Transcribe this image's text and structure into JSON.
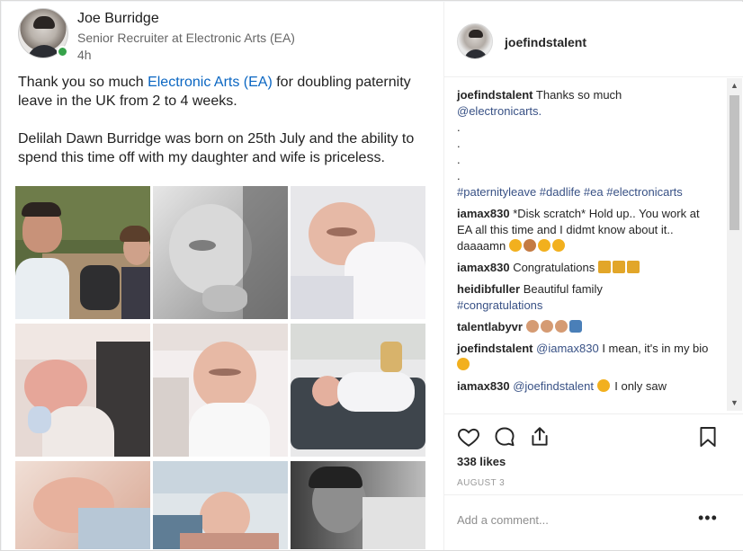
{
  "linkedin": {
    "author_name": "Joe Burridge",
    "author_title": "Senior Recruiter at Electronic Arts (EA)",
    "time_ago": "4h",
    "post_para1_a": "Thank you so much ",
    "post_para1_link": "Electronic Arts (EA)",
    "post_para1_b": " for doubling paternity leave in the UK from 2 to 4 weeks.",
    "post_para2": "Delilah Dawn Burridge was born on 25th July and the ability to spend this time off with my daughter and wife is priceless."
  },
  "instagram": {
    "username": "joefindstalent",
    "comments": [
      {
        "user": "joefindstalent",
        "text": "Thanks so much",
        "tags": [
          "@electronicarts."
        ],
        "dots": [
          ".",
          ".",
          ".",
          "."
        ],
        "hashtags": "#paternityleave #dadlife #ea #electronicarts"
      },
      {
        "user": "iamax830",
        "text": "*Disk scratch* Hold up.. You work at EA all this time and I didmt know about it.. daaaamn"
      },
      {
        "user": "iamax830",
        "text": "Congratulations"
      },
      {
        "user": "heidibfuller",
        "text": "Beautiful family",
        "hashtag": "#congratulations"
      },
      {
        "user": "talentlabyvr",
        "text": ""
      },
      {
        "user": "joefindstalent",
        "mention": "@iamax830",
        "text": " I mean, it's in my bio"
      },
      {
        "user": "iamax830",
        "mention": "@joefindstalent",
        "text": " I only saw"
      }
    ],
    "likes": "338 likes",
    "date": "AUGUST 3",
    "comment_placeholder": "Add a comment...",
    "more": "•••"
  },
  "icons": [
    "heart-icon",
    "comment-icon",
    "share-icon",
    "bookmark-icon",
    "more-icon",
    "scroll-up-icon",
    "scroll-down-icon"
  ]
}
